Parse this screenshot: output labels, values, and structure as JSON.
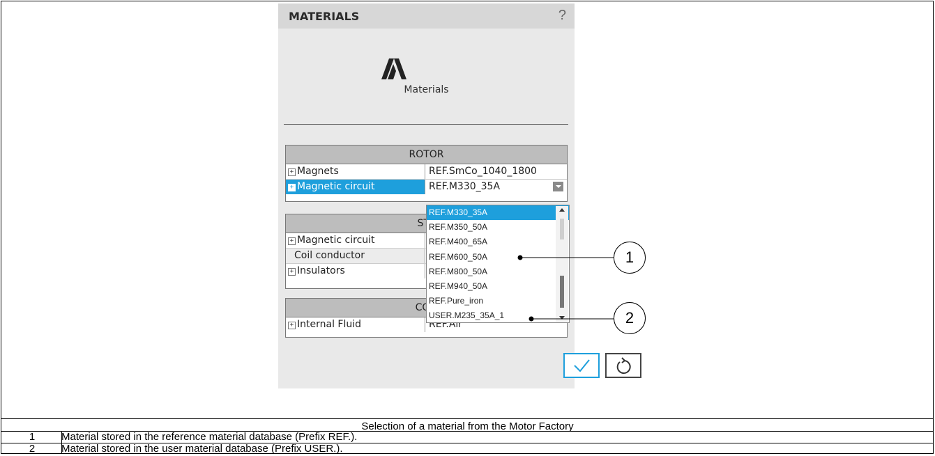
{
  "panel": {
    "title": "MATERIALS",
    "help": "?",
    "logo_label": "Materials"
  },
  "rotor": {
    "header": "ROTOR",
    "rows": [
      {
        "name": "Magnets",
        "value": "REF.SmCo_1040_1800"
      },
      {
        "name": "Magnetic circuit",
        "value": "REF.M330_35A"
      }
    ]
  },
  "stator": {
    "header": "STA",
    "rows": [
      {
        "name": "Magnetic circuit"
      },
      {
        "name": "Coil conductor"
      },
      {
        "name": "Insulators"
      }
    ]
  },
  "cooling": {
    "header": "COO",
    "rows": [
      {
        "name": "Internal Fluid",
        "value": "REF.Air"
      }
    ]
  },
  "dropdown": {
    "items": [
      "REF.M330_35A",
      "REF.M350_50A",
      "REF.M400_65A",
      "REF.M600_50A",
      "REF.M800_50A",
      "REF.M940_50A",
      "REF.Pure_iron",
      "USER.M235_35A_1"
    ],
    "selected": "REF.M330_35A"
  },
  "callouts": [
    "1",
    "2"
  ],
  "caption": "Selection of a material from the Motor Factory",
  "legend": [
    {
      "num": "1",
      "text": "Material stored in the reference material database (Prefix REF.)."
    },
    {
      "num": "2",
      "text": "Material stored in the user material database (Prefix USER.)."
    }
  ],
  "colors": {
    "accent": "#1e9fdc",
    "panel_bg": "#e9e9e9",
    "header_bg": "#bdbdbd"
  },
  "icons": [
    "materials-logo-icon",
    "expand-plus-icon",
    "dropdown-arrow-icon",
    "check-icon",
    "reset-icon"
  ]
}
